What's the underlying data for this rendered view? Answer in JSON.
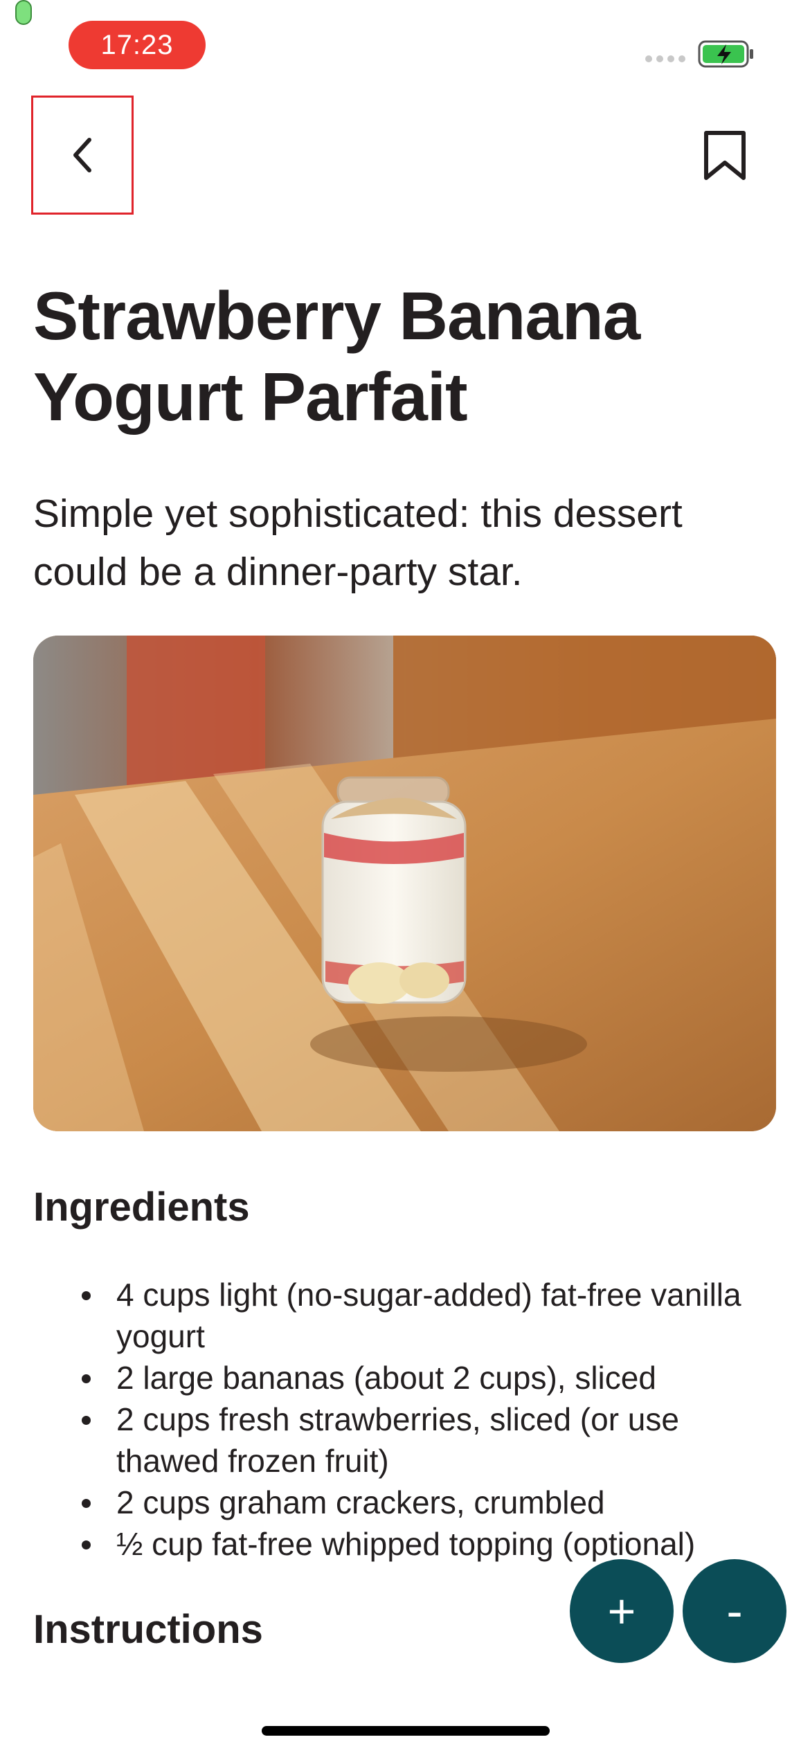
{
  "status_bar": {
    "time": "17:23",
    "battery_color": "#3ac34f"
  },
  "nav": {
    "back_icon": "chevron-left-icon",
    "bookmark_icon": "bookmark-icon"
  },
  "recipe": {
    "title": "Strawberry Banana Yogurt Parfait",
    "subtitle": "Simple yet sophisticated: this dessert could be a dinner-party star.",
    "ingredients_heading": "Ingredients",
    "ingredients": [
      "4 cups light (no-sugar-added) fat-free vanilla yogurt",
      "2 large bananas (about 2 cups), sliced",
      "2 cups fresh strawberries, sliced (or use thawed frozen fruit)",
      "2 cups graham crackers, crumbled",
      "½ cup fat-free whipped topping (optional)"
    ],
    "instructions_heading": "Instructions"
  },
  "controls": {
    "increase_label": "+",
    "decrease_label": "-",
    "accent_color": "#0b4d57"
  }
}
